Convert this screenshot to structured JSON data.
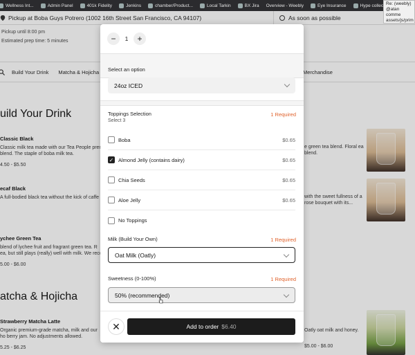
{
  "bookmarks": [
    {
      "label": "Wellness Int..."
    },
    {
      "label": "Admin Panel"
    },
    {
      "label": "401k Fidelity"
    },
    {
      "label": "Jenkins"
    },
    {
      "label": "chamber/Product..."
    },
    {
      "label": "Local Tarkin"
    },
    {
      "label": "BX Jira"
    },
    {
      "label": "Overview - Weebly"
    },
    {
      "label": "Eye Insurance"
    },
    {
      "label": "Hype collection"
    }
  ],
  "tooltip": "Re: (weebly) @atan comme assets/js/prim",
  "page": {
    "pickup": "Pickup at Boba Guys Potrero (1002 16th Street San Francisco, CA 94107)",
    "asap": "As soon as possible",
    "pickup_until": "Pickup until 8:00 pm",
    "prep_time": "Estimated prep time: 5 minutes",
    "nav": [
      "Build Your Drink",
      "Matcha & Hojicha",
      "Merchandise"
    ],
    "section_build": "uild Your Drink",
    "section_matcha": "atcha & Hojicha",
    "items_left": [
      {
        "name": "Classic Black",
        "desc": "Classic milk tea made with our Tea People prem blend. The staple of boba milk tea.",
        "price": "4.50 - $5.50"
      },
      {
        "name": "ecaf Black",
        "desc": "A full-bodied black tea without the kick of caffe",
        "price": ""
      },
      {
        "name": "ychee Green Tea",
        "desc": "blend of lychee fruit and fragrant green tea. R ea, but still plays (really) well with milk. We reco",
        "price": "5.00 - $6.00"
      },
      {
        "name": "Strawberry Matcha Latte",
        "desc": "Organic premium-grade matcha, milk and our ho berry jam. No adjustments allowed.",
        "price": "5.25 - $6.25"
      }
    ],
    "items_right": [
      {
        "desc": "e green tea blend. Floral ea blend."
      },
      {
        "desc": "with the sweet fullness of a rose bouquet with its..."
      },
      {
        "desc": "Oatly oat milk and honey."
      }
    ],
    "price_right_bottom": "$5.00 - $6.00"
  },
  "modal": {
    "quantity": "1",
    "option_label": "Select an option",
    "option_value": "24oz ICED",
    "toppings_label": "Toppings Selection",
    "toppings_required": "1 Required",
    "toppings_sub": "Select 3",
    "toppings": [
      {
        "label": "Boba",
        "price": "$0.65",
        "checked": false
      },
      {
        "label": "Almond Jelly (contains dairy)",
        "price": "$0.65",
        "checked": true
      },
      {
        "label": "Chia Seeds",
        "price": "$0.65",
        "checked": false
      },
      {
        "label": "Aloe Jelly",
        "price": "$0.65",
        "checked": false
      },
      {
        "label": "No Toppings",
        "price": "",
        "checked": false
      }
    ],
    "milk_label": "Milk (Build Your Own)",
    "milk_required": "1 Required",
    "milk_value": "Oat Milk (Oatly)",
    "sweet_label": "Sweetness (0-100%)",
    "sweet_required": "1 Required",
    "sweet_value": "50% (recommended)",
    "add_label": "Add to order",
    "add_price": "$6.40"
  },
  "colors": {
    "required": "#e0622b",
    "button": "#1c1c1c"
  }
}
